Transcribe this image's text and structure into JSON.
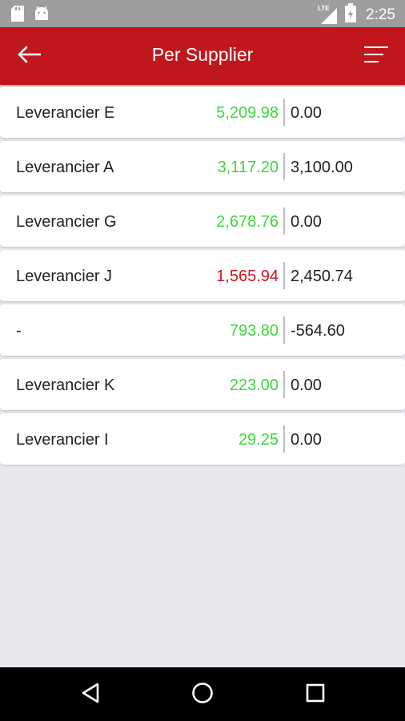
{
  "status_bar": {
    "time": "2:25",
    "network_label": "LTE",
    "icons": [
      "sd-card-icon",
      "android-icon",
      "signal-icon",
      "battery-icon"
    ]
  },
  "app_bar": {
    "title": "Per Supplier",
    "back_icon": "arrow-left-icon",
    "menu_icon": "menu-icon"
  },
  "colors": {
    "app_bar": "#c0171d",
    "positive": "#3cd73c",
    "negative": "#c8161d",
    "background": "#e6e8ee"
  },
  "suppliers": [
    {
      "name": "Leverancier E",
      "amount": "5,209.98",
      "amount_status": "green",
      "second": "0.00"
    },
    {
      "name": "Leverancier A",
      "amount": "3,117.20",
      "amount_status": "green",
      "second": "3,100.00"
    },
    {
      "name": "Leverancier G",
      "amount": "2,678.76",
      "amount_status": "green",
      "second": "0.00"
    },
    {
      "name": "Leverancier J",
      "amount": "1,565.94",
      "amount_status": "red",
      "second": "2,450.74"
    },
    {
      "name": "-",
      "amount": "793.80",
      "amount_status": "green",
      "second": "-564.60"
    },
    {
      "name": "Leverancier K",
      "amount": "223.00",
      "amount_status": "green",
      "second": "0.00"
    },
    {
      "name": "Leverancier I",
      "amount": "29.25",
      "amount_status": "green",
      "second": "0.00"
    }
  ],
  "nav_bar": {
    "icons": [
      "back-triangle-icon",
      "home-circle-icon",
      "recents-square-icon"
    ]
  }
}
